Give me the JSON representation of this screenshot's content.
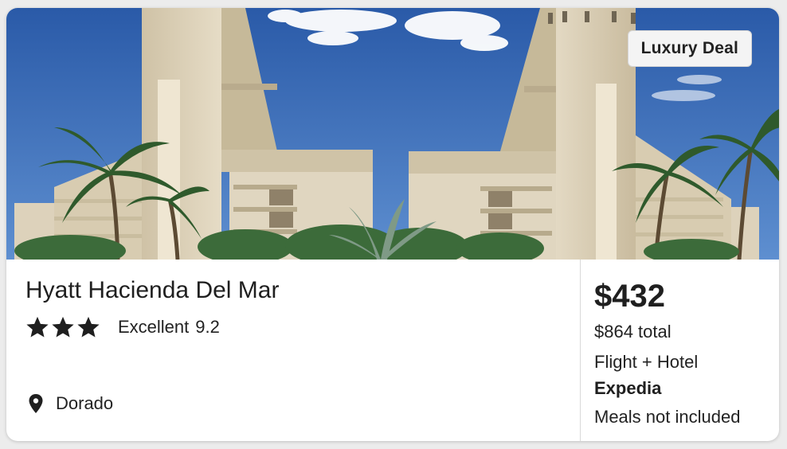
{
  "badge": {
    "label": "Luxury Deal"
  },
  "hotel": {
    "name": "Hyatt Hacienda Del Mar",
    "star_count": 3,
    "rating_word": "Excellent",
    "rating_score": "9.2",
    "location": "Dorado"
  },
  "pricing": {
    "price": "$432",
    "total": "$864 total",
    "package": "Flight + Hotel",
    "provider": "Expedia",
    "meals": "Meals not included"
  },
  "icons": {
    "star": "star-icon",
    "location": "map-pin-icon"
  },
  "colors": {
    "sky": "#3565b4",
    "building": "#d9cdb4",
    "palm": "#2f5a2c",
    "text": "#1f1f1f"
  }
}
